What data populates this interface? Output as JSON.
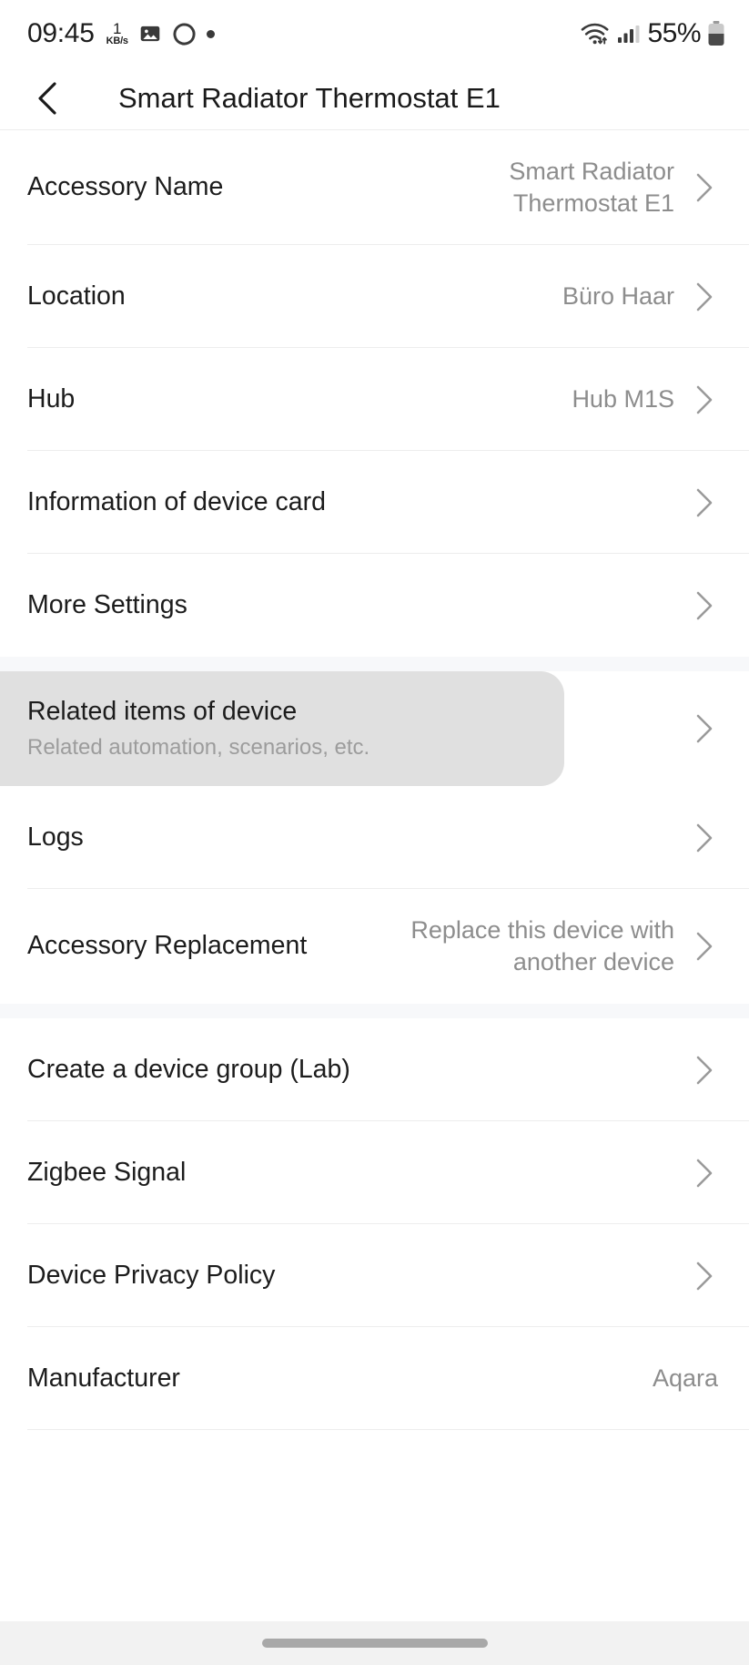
{
  "status_bar": {
    "time": "09:45",
    "net_speed_value": "1",
    "net_speed_unit": "KB/s",
    "battery_percent": "55%",
    "icons": [
      "image-icon",
      "bixby-circle-icon",
      "dot-icon",
      "wifi-icon",
      "cellular-signal-icon",
      "battery-icon"
    ]
  },
  "header": {
    "title": "Smart Radiator Thermostat E1",
    "back_label": "Back"
  },
  "groups": [
    {
      "rows": [
        {
          "label": "Accessory Name",
          "value": "Smart Radiator Thermostat E1",
          "chevron": true
        },
        {
          "label": "Location",
          "value": "Büro Haar",
          "chevron": true
        },
        {
          "label": "Hub",
          "value": "Hub M1S",
          "chevron": true
        },
        {
          "label": "Information of device card",
          "value": "",
          "chevron": true
        },
        {
          "label": "More Settings",
          "value": "",
          "chevron": true
        }
      ]
    },
    {
      "rows": [
        {
          "label": "Related items of device",
          "sublabel": "Related automation, scenarios, etc.",
          "value": "",
          "chevron": true,
          "highlighted": true
        },
        {
          "label": "Logs",
          "value": "",
          "chevron": true
        },
        {
          "label": "Accessory Replacement",
          "value": "Replace this device with another device",
          "chevron": true
        }
      ]
    },
    {
      "rows": [
        {
          "label": "Create a device group (Lab)",
          "value": "",
          "chevron": true
        },
        {
          "label": "Zigbee Signal",
          "value": "",
          "chevron": true
        },
        {
          "label": "Device Privacy Policy",
          "value": "",
          "chevron": true
        },
        {
          "label": "Manufacturer",
          "value": "Aqara",
          "chevron": false
        }
      ]
    }
  ],
  "nav_bar": {
    "handle": "home-gesture-handle"
  },
  "colors": {
    "background": "#ffffff",
    "band": "#f7f8fa",
    "highlight": "#e0e0e0",
    "label": "#1c1c1c",
    "value": "#8d8d8d",
    "separator": "#ededed",
    "nav_background": "#f2f2f2"
  }
}
